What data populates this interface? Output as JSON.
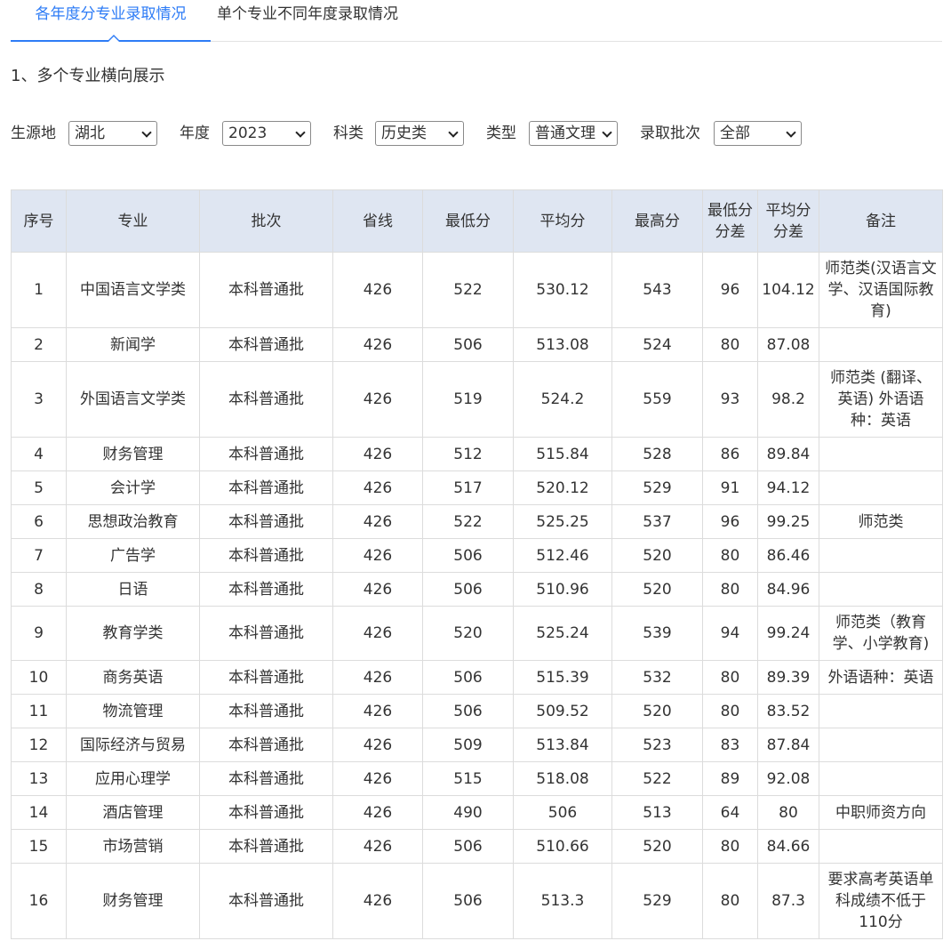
{
  "tabs": {
    "active": "各年度分专业录取情况",
    "inactive": "单个专业不同年度录取情况"
  },
  "section_title": "1、多个专业横向展示",
  "filters": {
    "source_label": "生源地",
    "source_value": "湖北",
    "year_label": "年度",
    "year_value": "2023",
    "subject_label": "科类",
    "subject_value": "历史类",
    "type_label": "类型",
    "type_value": "普通文理",
    "batch_label": "录取批次",
    "batch_value": "全部"
  },
  "table": {
    "headers": {
      "index": "序号",
      "major": "专业",
      "batch": "批次",
      "province_line": "省线",
      "min": "最低分",
      "avg": "平均分",
      "max": "最高分",
      "min_diff_1": "最低分",
      "min_diff_2": "分差",
      "avg_diff_1": "平均分",
      "avg_diff_2": "分差",
      "note": "备注"
    },
    "rows": [
      {
        "index": "1",
        "major": "中国语言文学类",
        "batch": "本科普通批",
        "province_line": "426",
        "min": "522",
        "avg": "530.12",
        "max": "543",
        "min_diff": "96",
        "avg_diff": "104.12",
        "note": "师范类(汉语言文学、汉语国际教育)"
      },
      {
        "index": "2",
        "major": "新闻学",
        "batch": "本科普通批",
        "province_line": "426",
        "min": "506",
        "avg": "513.08",
        "max": "524",
        "min_diff": "80",
        "avg_diff": "87.08",
        "note": ""
      },
      {
        "index": "3",
        "major": "外国语言文学类",
        "batch": "本科普通批",
        "province_line": "426",
        "min": "519",
        "avg": "524.2",
        "max": "559",
        "min_diff": "93",
        "avg_diff": "98.2",
        "note": "师范类 (翻译、英语) 外语语种：英语"
      },
      {
        "index": "4",
        "major": "财务管理",
        "batch": "本科普通批",
        "province_line": "426",
        "min": "512",
        "avg": "515.84",
        "max": "528",
        "min_diff": "86",
        "avg_diff": "89.84",
        "note": ""
      },
      {
        "index": "5",
        "major": "会计学",
        "batch": "本科普通批",
        "province_line": "426",
        "min": "517",
        "avg": "520.12",
        "max": "529",
        "min_diff": "91",
        "avg_diff": "94.12",
        "note": ""
      },
      {
        "index": "6",
        "major": "思想政治教育",
        "batch": "本科普通批",
        "province_line": "426",
        "min": "522",
        "avg": "525.25",
        "max": "537",
        "min_diff": "96",
        "avg_diff": "99.25",
        "note": "师范类"
      },
      {
        "index": "7",
        "major": "广告学",
        "batch": "本科普通批",
        "province_line": "426",
        "min": "506",
        "avg": "512.46",
        "max": "520",
        "min_diff": "80",
        "avg_diff": "86.46",
        "note": ""
      },
      {
        "index": "8",
        "major": "日语",
        "batch": "本科普通批",
        "province_line": "426",
        "min": "506",
        "avg": "510.96",
        "max": "520",
        "min_diff": "80",
        "avg_diff": "84.96",
        "note": ""
      },
      {
        "index": "9",
        "major": "教育学类",
        "batch": "本科普通批",
        "province_line": "426",
        "min": "520",
        "avg": "525.24",
        "max": "539",
        "min_diff": "94",
        "avg_diff": "99.24",
        "note": "师范类（教育学、小学教育)"
      },
      {
        "index": "10",
        "major": "商务英语",
        "batch": "本科普通批",
        "province_line": "426",
        "min": "506",
        "avg": "515.39",
        "max": "532",
        "min_diff": "80",
        "avg_diff": "89.39",
        "note": "外语语种：英语"
      },
      {
        "index": "11",
        "major": "物流管理",
        "batch": "本科普通批",
        "province_line": "426",
        "min": "506",
        "avg": "509.52",
        "max": "520",
        "min_diff": "80",
        "avg_diff": "83.52",
        "note": ""
      },
      {
        "index": "12",
        "major": "国际经济与贸易",
        "batch": "本科普通批",
        "province_line": "426",
        "min": "509",
        "avg": "513.84",
        "max": "523",
        "min_diff": "83",
        "avg_diff": "87.84",
        "note": ""
      },
      {
        "index": "13",
        "major": "应用心理学",
        "batch": "本科普通批",
        "province_line": "426",
        "min": "515",
        "avg": "518.08",
        "max": "522",
        "min_diff": "89",
        "avg_diff": "92.08",
        "note": ""
      },
      {
        "index": "14",
        "major": "酒店管理",
        "batch": "本科普通批",
        "province_line": "426",
        "min": "490",
        "avg": "506",
        "max": "513",
        "min_diff": "64",
        "avg_diff": "80",
        "note": "中职师资方向"
      },
      {
        "index": "15",
        "major": "市场营销",
        "batch": "本科普通批",
        "province_line": "426",
        "min": "506",
        "avg": "510.66",
        "max": "520",
        "min_diff": "80",
        "avg_diff": "84.66",
        "note": ""
      },
      {
        "index": "16",
        "major": "财务管理",
        "batch": "本科普通批",
        "province_line": "426",
        "min": "506",
        "avg": "513.3",
        "max": "529",
        "min_diff": "80",
        "avg_diff": "87.3",
        "note": "要求高考英语单科成绩不低于110分"
      }
    ]
  }
}
